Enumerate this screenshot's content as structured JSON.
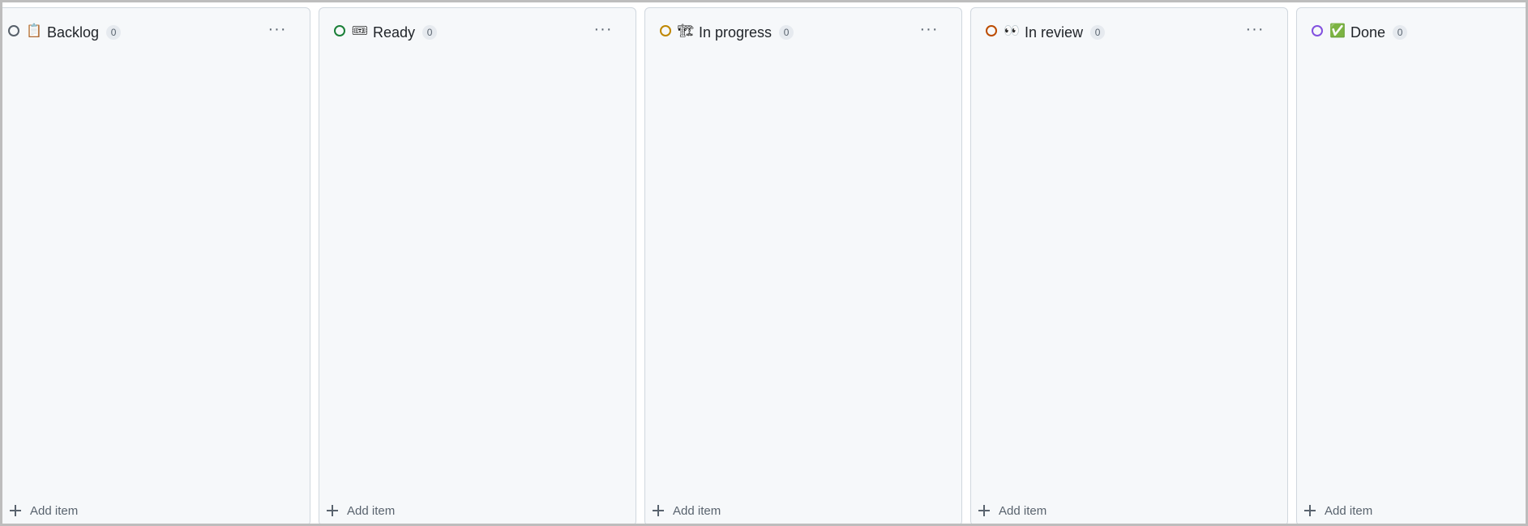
{
  "board": {
    "columns": [
      {
        "title": "Backlog",
        "count": "0",
        "emoji": "📋",
        "status_color": "#57606a",
        "add_label": "Add item",
        "more_label": "···"
      },
      {
        "title": "Ready",
        "count": "0",
        "emoji": "🎟",
        "status_color": "#1a7f37",
        "add_label": "Add item",
        "more_label": "···"
      },
      {
        "title": "In progress",
        "count": "0",
        "emoji": "🏗",
        "status_color": "#bf8700",
        "add_label": "Add item",
        "more_label": "···"
      },
      {
        "title": "In review",
        "count": "0",
        "emoji": "👀",
        "status_color": "#bc4c00",
        "add_label": "Add item",
        "more_label": "···"
      },
      {
        "title": "Done",
        "count": "0",
        "emoji": "✅",
        "status_color": "#8250df",
        "add_label": "Add item",
        "more_label": "···"
      }
    ]
  },
  "floating": {
    "mic_icon": "microphone-icon"
  }
}
